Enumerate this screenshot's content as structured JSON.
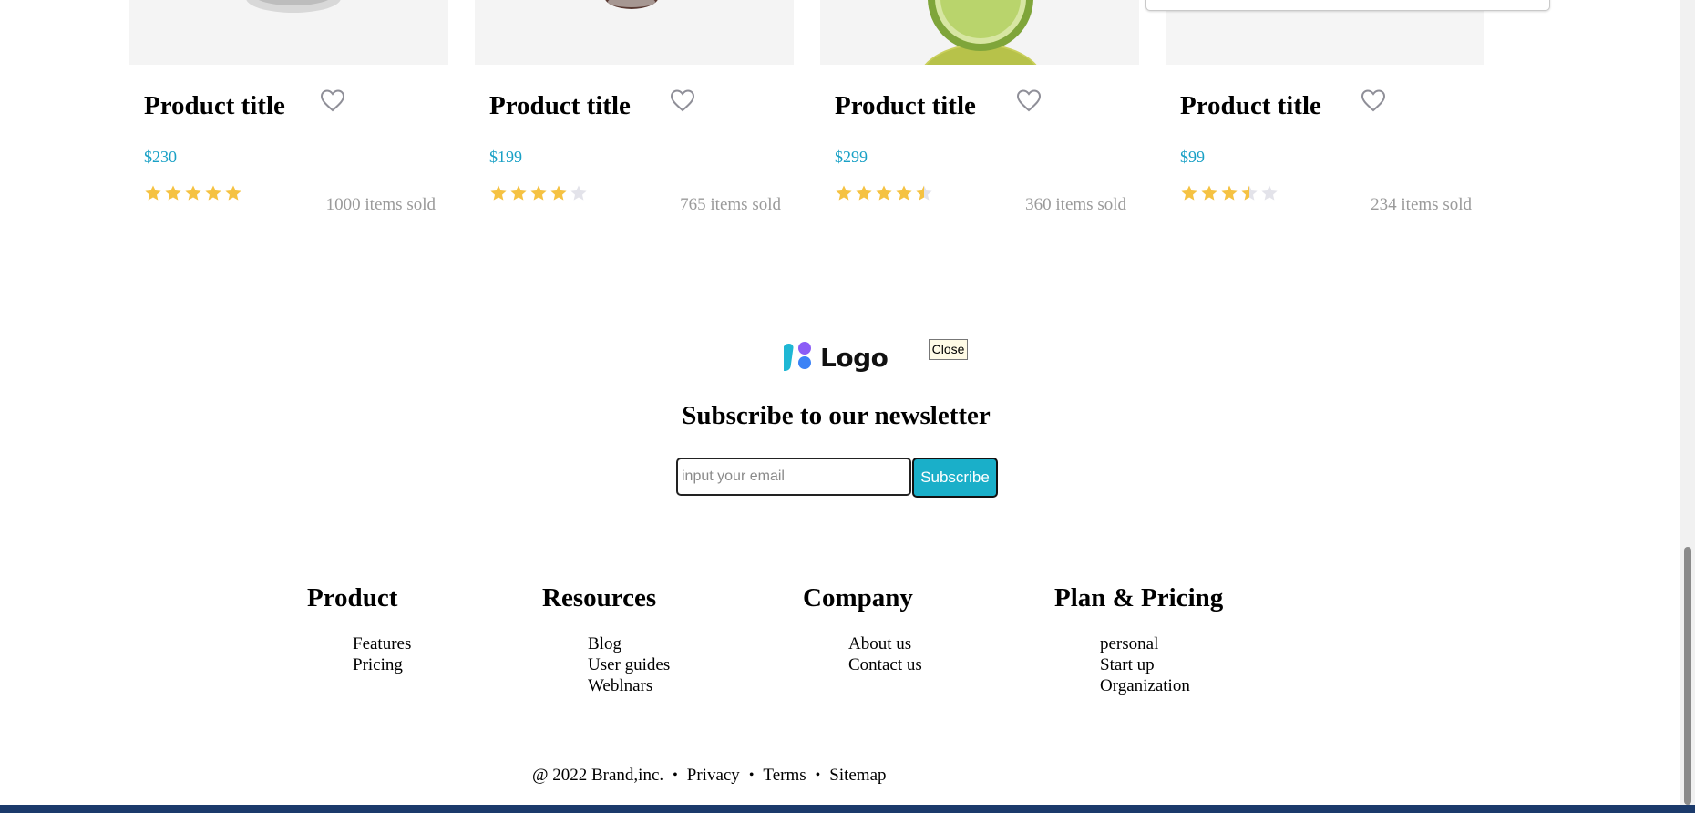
{
  "products": [
    {
      "title": "Product title",
      "price": "$230",
      "rating": 5,
      "sold": "1000 items sold",
      "image": "product-photo"
    },
    {
      "title": "Product title",
      "price": "$199",
      "rating": 4,
      "sold": "765 items sold",
      "image": "product-photo"
    },
    {
      "title": "Product title",
      "price": "$299",
      "rating": 4.5,
      "sold": "360 items sold",
      "image": "lime-photo"
    },
    {
      "title": "Product title",
      "price": "$99",
      "rating": 3.5,
      "sold": "234 items sold",
      "image": "product-photo"
    }
  ],
  "footer": {
    "logo_text": "Logo",
    "close_label": "Close",
    "newsletter_title": "Subscribe to our newsletter",
    "email_placeholder": "input your email",
    "subscribe_label": "Subscribe",
    "columns": [
      {
        "heading": "Product",
        "links": [
          "Features",
          "Pricing"
        ]
      },
      {
        "heading": "Resources",
        "links": [
          "Blog",
          "User guides",
          "Weblnars"
        ]
      },
      {
        "heading": "Company",
        "links": [
          "About us",
          "Contact us"
        ]
      },
      {
        "heading": "Plan & Pricing",
        "links": [
          "personal",
          "Start up",
          "Organization"
        ]
      }
    ],
    "copyright": "@ 2022 Brand,inc.",
    "legal_links": [
      "Privacy",
      "Terms",
      "Sitemap"
    ],
    "separator": "•"
  },
  "colors": {
    "accent": "#1aafc9",
    "price": "#1aa1c6",
    "star_filled": "#f5c242",
    "star_empty": "#e3e3ea",
    "muted": "#9a9a9a"
  },
  "icons": {
    "favorite": "heart-icon",
    "rating": "star-icon"
  }
}
